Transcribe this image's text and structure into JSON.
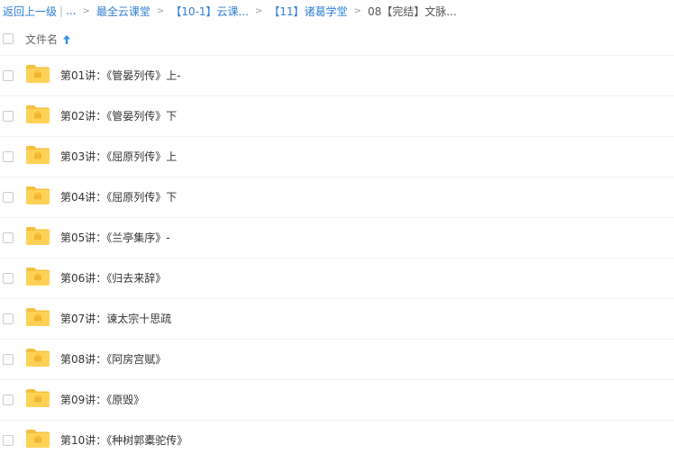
{
  "breadcrumb": {
    "back": "返回上一级",
    "separator": "|",
    "ellipsis": "...",
    "items": [
      "最全云课堂",
      "【10-1】云课...",
      "【11】诸葛学堂"
    ],
    "current": "08【完结】文脉..."
  },
  "header": {
    "column_title": "文件名"
  },
  "colors": {
    "link": "#2e7fd6",
    "folder": "#ffd257",
    "folder_tab": "#f5c03e",
    "sort_arrow": "#2e90f2"
  },
  "files": [
    {
      "name": "第01讲：《管晏列传》上-"
    },
    {
      "name": "第02讲：《管晏列传》下"
    },
    {
      "name": "第03讲：《屈原列传》上"
    },
    {
      "name": "第04讲：《屈原列传》下"
    },
    {
      "name": "第05讲：《兰亭集序》-"
    },
    {
      "name": "第06讲：《归去来辞》"
    },
    {
      "name": "第07讲：谏太宗十思疏"
    },
    {
      "name": "第08讲：《阿房宫赋》"
    },
    {
      "name": "第09讲：《原毁》"
    },
    {
      "name": "第10讲：《种树郭橐驼传》"
    }
  ]
}
